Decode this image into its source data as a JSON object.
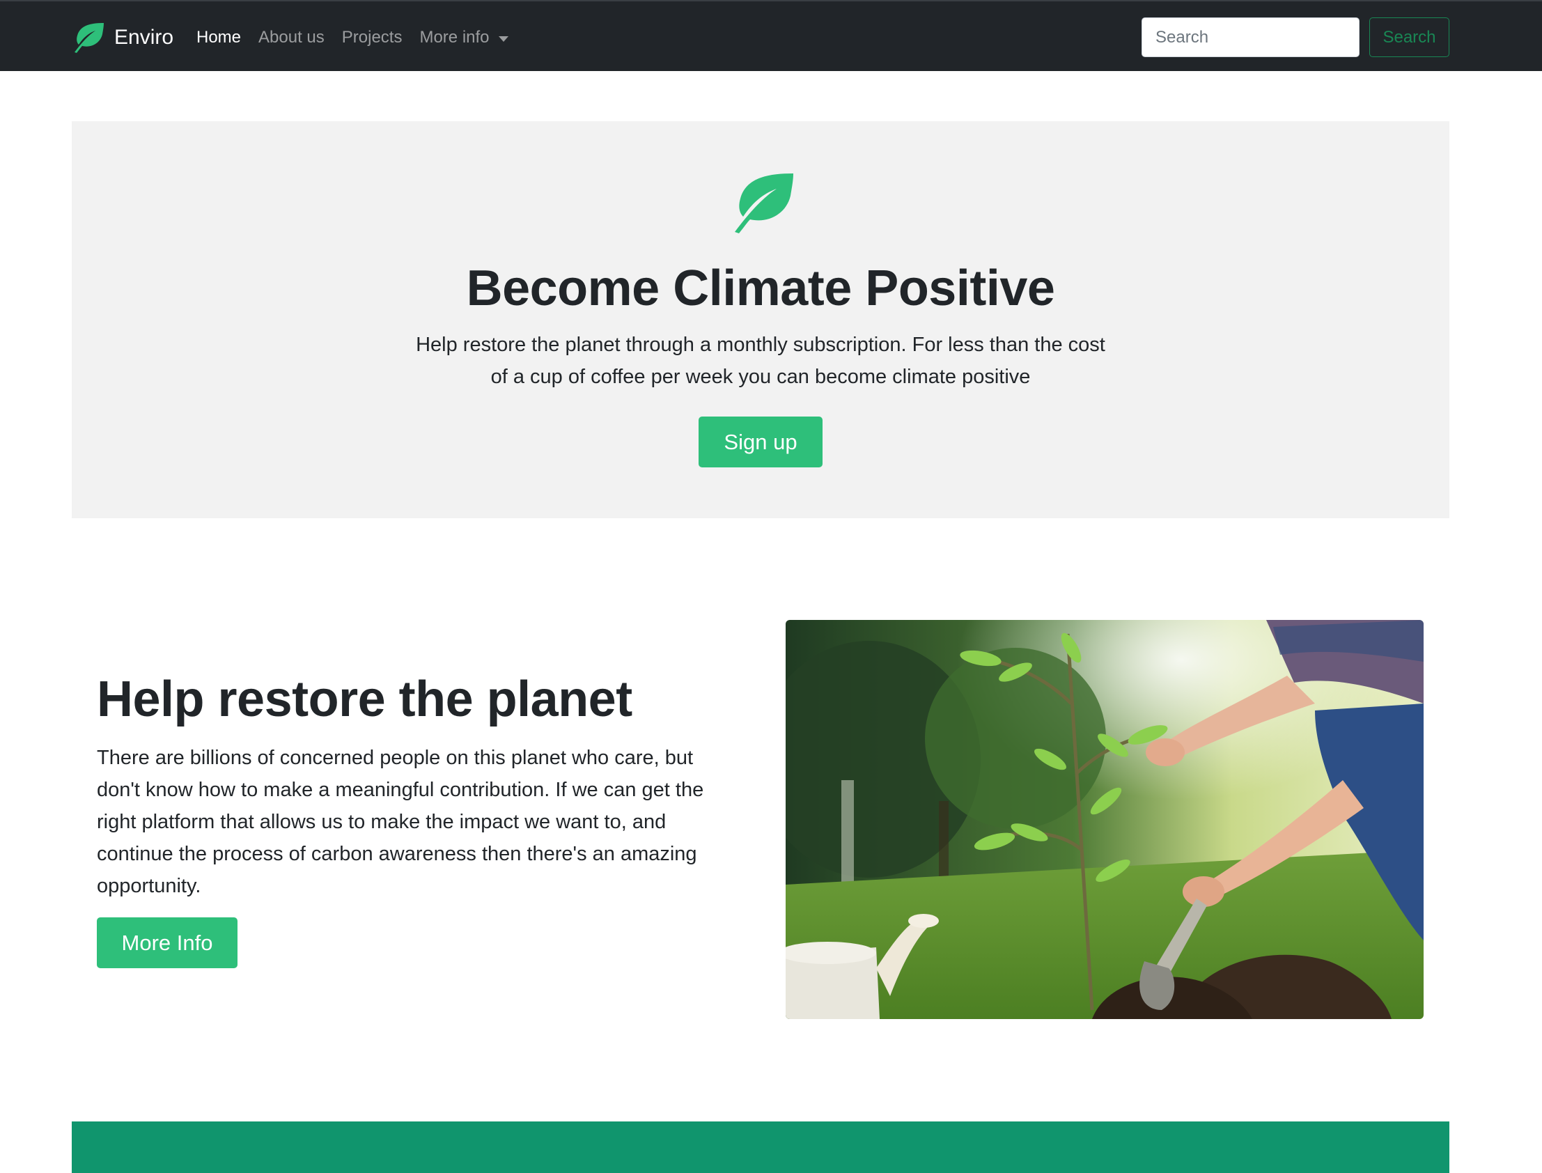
{
  "navbar": {
    "brand": "Enviro",
    "links": [
      {
        "label": "Home",
        "active": true
      },
      {
        "label": "About us",
        "active": false
      },
      {
        "label": "Projects",
        "active": false
      }
    ],
    "dropdown_label": "More info",
    "search_placeholder": "Search",
    "search_button": "Search"
  },
  "hero": {
    "title": "Become Climate Positive",
    "text": "Help restore the planet through a monthly subscription. For less than the cost of a cup of coffee per week you can become climate positive",
    "button": "Sign up",
    "icon": "leaf-icon"
  },
  "feature": {
    "title": "Help restore the planet",
    "text": "There are billions of concerned people on this planet who care, but don't know how to make a meaningful contribution. If we can get the right platform that allows us to make the impact we want to, and continue the process of carbon awareness then there's an amazing opportunity.",
    "button": "More Info"
  },
  "colors": {
    "navbar_bg": "#212529",
    "accent_green": "#2ebf7a",
    "outline_green": "#198754",
    "hero_bg": "#f2f2f2",
    "band_green": "#10956d"
  }
}
